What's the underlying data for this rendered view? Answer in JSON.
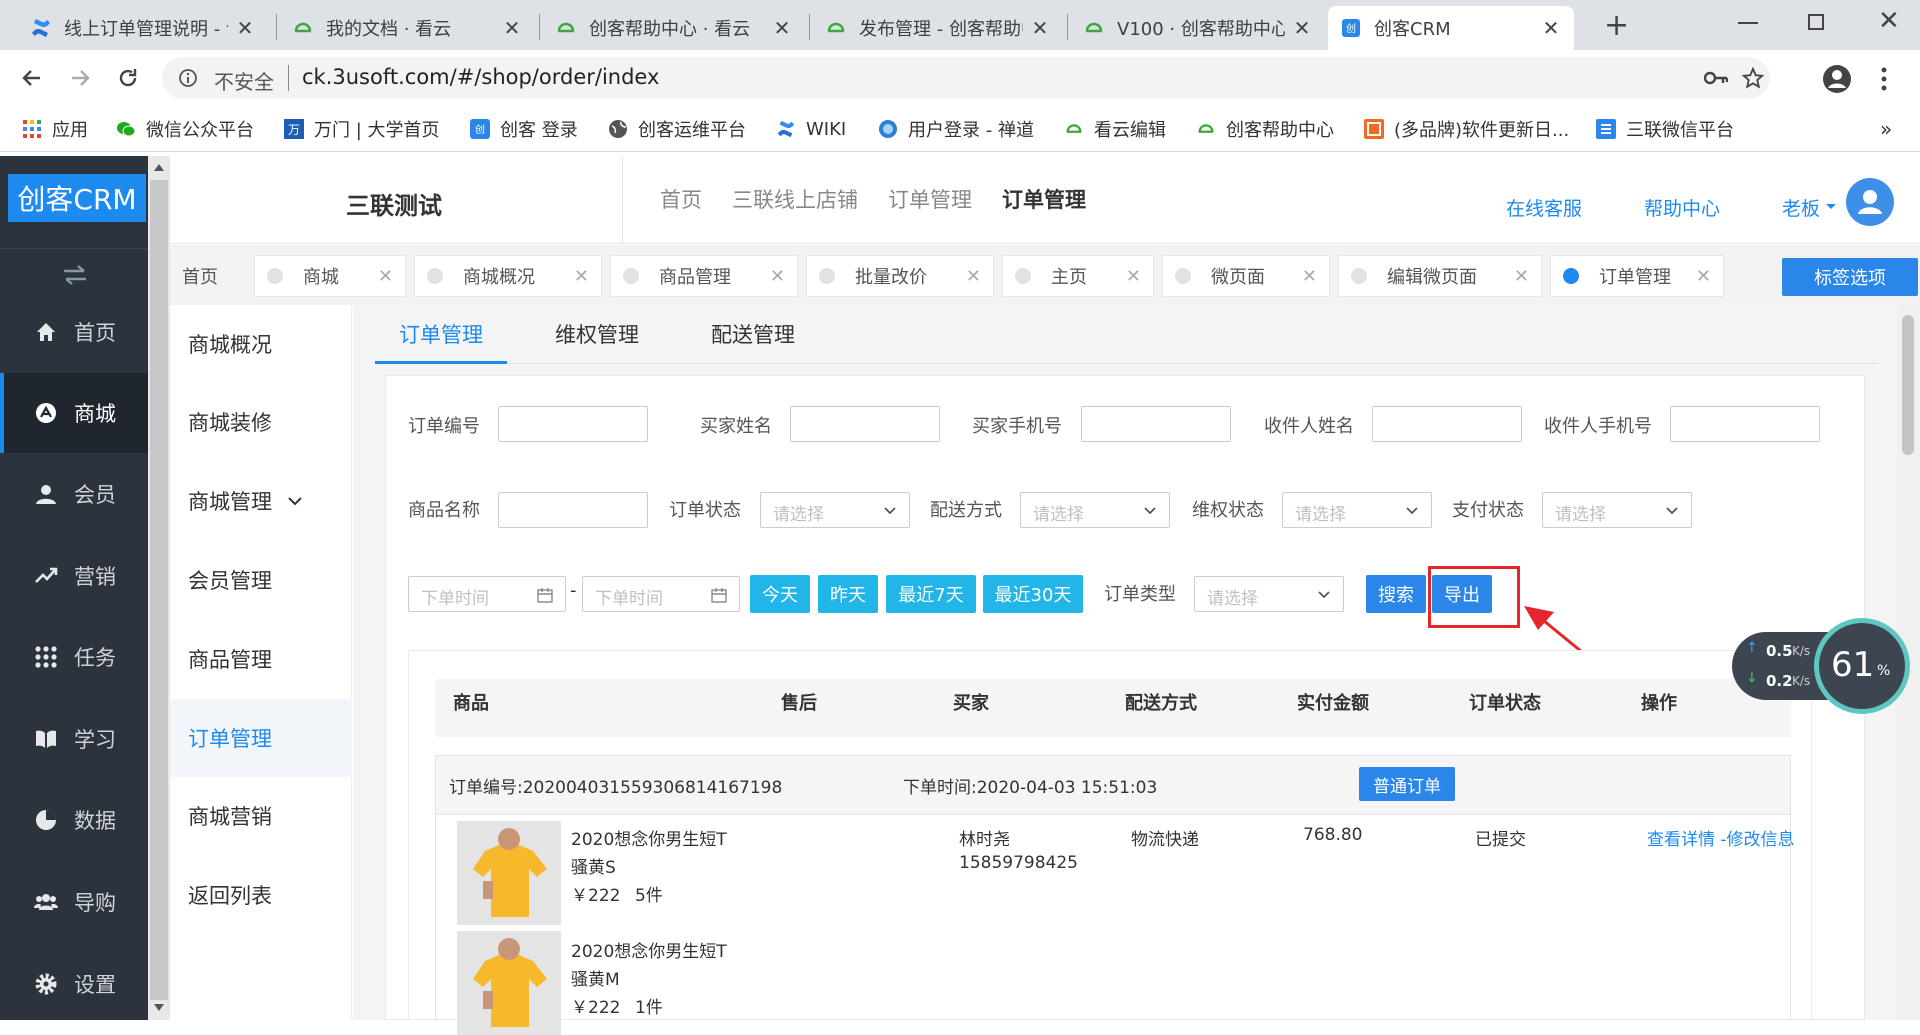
{
  "browser": {
    "tabs": [
      {
        "title": "线上订单管理说明 - 创客帮助中心",
        "icon": "confluence-icon"
      },
      {
        "title": "我的文档 · 看云",
        "icon": "kancloud-icon"
      },
      {
        "title": "创客帮助中心 · 看云",
        "icon": "kancloud-icon"
      },
      {
        "title": "发布管理 - 创客帮助中心",
        "icon": "kancloud-icon"
      },
      {
        "title": "V100 · 创客帮助中心",
        "icon": "kancloud-icon"
      },
      {
        "title": "创客CRM",
        "icon": "chuangke-icon"
      }
    ],
    "security": "不安全",
    "url": "ck.3usoft.com/#/shop/order/index",
    "bookmarks": [
      "应用",
      "微信公众平台",
      "万门 | 大学首页",
      "创客 登录",
      "创客运维平台",
      "WIKI",
      "用户登录 - 禅道",
      "看云编辑",
      "创客帮助中心",
      "(多品牌)软件更新日...",
      "三联微信平台"
    ],
    "bookmarks_more": "»"
  },
  "app": {
    "logo": "创客CRM",
    "company": "三联测试",
    "breadcrumb": [
      "首页",
      "三联线上店铺",
      "订单管理",
      "订单管理"
    ],
    "header_links": {
      "service": "在线客服",
      "help": "帮助中心",
      "user": "老板"
    },
    "sidebar": [
      {
        "label": "首页",
        "icon": "home-icon"
      },
      {
        "label": "商城",
        "icon": "shop-icon"
      },
      {
        "label": "会员",
        "icon": "user-icon"
      },
      {
        "label": "营销",
        "icon": "trend-icon"
      },
      {
        "label": "任务",
        "icon": "grid-icon"
      },
      {
        "label": "学习",
        "icon": "book-icon"
      },
      {
        "label": "数据",
        "icon": "pie-icon"
      },
      {
        "label": "导购",
        "icon": "group-icon"
      },
      {
        "label": "设置",
        "icon": "gear-icon"
      }
    ],
    "tags": [
      "首页",
      "商城",
      "商城概况",
      "商品管理",
      "批量改价",
      "主页",
      "微页面",
      "编辑微页面",
      "订单管理"
    ],
    "tag_options": "标签选项",
    "submenu": [
      "商城概况",
      "商城装修",
      "商城管理",
      "会员管理",
      "商品管理",
      "订单管理",
      "商城营销",
      "返回列表"
    ],
    "content_tabs": [
      "订单管理",
      "维权管理",
      "配送管理"
    ]
  },
  "filters": {
    "order_no": "订单编号",
    "buyer_name": "买家姓名",
    "buyer_phone": "买家手机号",
    "receiver_name": "收件人姓名",
    "receiver_phone": "收件人手机号",
    "product_name": "商品名称",
    "order_status": "订单状态",
    "delivery": "配送方式",
    "rights_status": "维权状态",
    "pay_status": "支付状态",
    "select_placeholder": "请选择",
    "date_placeholder": "下单时间",
    "date_sep": "-",
    "quick": [
      "今天",
      "昨天",
      "最近7天",
      "最近30天"
    ],
    "order_type": "订单类型",
    "search": "搜索",
    "export": "导出"
  },
  "table": {
    "headers": [
      "商品",
      "售后",
      "买家",
      "配送方式",
      "实付金额",
      "订单状态",
      "操作"
    ],
    "order": {
      "no": "订单编号:202004031559306814167198",
      "time": "下单时间:2020-04-03 15:51:03",
      "type": "普通订单",
      "items": [
        {
          "name1": "2020想念你男生短T",
          "name2": "骚黄S",
          "price": "￥222",
          "qty": "5件"
        },
        {
          "name1": "2020想念你男生短T",
          "name2": "骚黄M",
          "price": "￥222",
          "qty": "1件"
        }
      ],
      "buyer": "林时尧",
      "phone": "15859798425",
      "delivery": "物流快递",
      "amount": "768.80",
      "status": "已提交",
      "actions": "查看详情 -修改信息"
    }
  },
  "speed_widget": {
    "up": "0.5",
    "down": "0.2",
    "unit": "K/s",
    "percent": "61",
    "percent_unit": "%"
  }
}
